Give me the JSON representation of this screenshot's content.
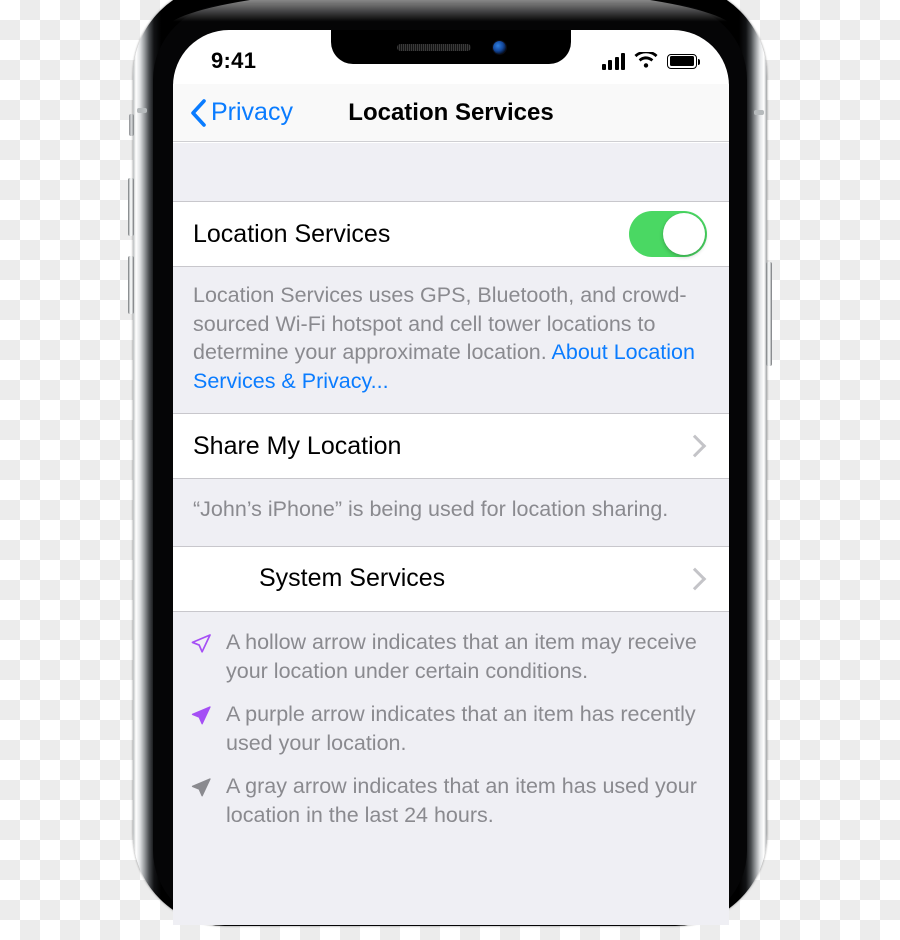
{
  "device": {
    "type": "iphone-x",
    "frame_color": "#050506"
  },
  "status_bar": {
    "time": "9:41",
    "cellular_icon": "signal-bars-icon",
    "wifi_icon": "wifi-icon",
    "battery_icon": "battery-full-icon"
  },
  "nav_bar": {
    "back_label": "Privacy",
    "back_icon": "chevron-left-icon",
    "title": "Location Services"
  },
  "colors": {
    "accent_blue": "#0a7cff",
    "toggle_green": "#4ad863",
    "group_background": "#efeff4",
    "cell_background": "#ffffff",
    "secondary_text": "#8a8a8f",
    "arrow_purple": "#a54ff5",
    "arrow_gray": "#8a8a8f"
  },
  "sections": [
    {
      "id": "location-services",
      "rows": [
        {
          "label": "Location Services",
          "control": "toggle",
          "toggle_state": "on"
        }
      ],
      "footer": {
        "text": "Location Services uses GPS, Bluetooth, and crowd-sourced Wi-Fi hotspot and cell tower locations to determine your approximate location. ",
        "link": "About Location Services & Privacy..."
      }
    },
    {
      "id": "share-my-location",
      "rows": [
        {
          "label": "Share My Location",
          "control": "chevron"
        }
      ],
      "footer": {
        "text": "“John’s iPhone” is being used for location sharing.",
        "link": ""
      }
    },
    {
      "id": "system-services",
      "rows": [
        {
          "label": "System Services",
          "control": "chevron",
          "indented": true
        }
      ]
    }
  ],
  "legend": [
    {
      "icon": "hollow-arrow-icon",
      "text": "A hollow arrow indicates that an item may receive your location under certain conditions."
    },
    {
      "icon": "purple-arrow-icon",
      "text": "A purple arrow indicates that an item has recently used your location."
    },
    {
      "icon": "gray-arrow-icon",
      "text": "A gray arrow indicates that an item has used your location in the last 24 hours."
    }
  ]
}
